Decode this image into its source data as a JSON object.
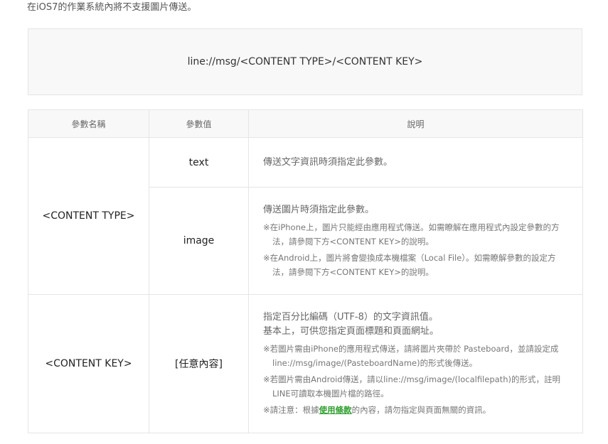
{
  "intro_text": "在iOS7的作業系統內將不支援圖片傳送。",
  "url_scheme": "line://msg/<CONTENT TYPE>/<CONTENT KEY>",
  "table": {
    "headers": [
      "參數名稱",
      "參數值",
      "說明"
    ],
    "content_type": {
      "name": "<CONTENT TYPE>",
      "text": {
        "value": "text",
        "desc": "傳送文字資訊時須指定此參數。"
      },
      "image": {
        "value": "image",
        "desc": "傳送圖片時須指定此參數。",
        "note1": "※在iPhone上，圖片只能經由應用程式傳送。如需瞭解在應用程式內設定參數的方法，請參閱下方<CONTENT KEY>的說明。",
        "note2": "※在Android上，圖片將會變換成本機檔案（Local File）。如需瞭解參數的設定方法，請參閱下方<CONTENT KEY>的說明。"
      }
    },
    "content_key": {
      "name": "<CONTENT KEY>",
      "value": "[任意內容]",
      "desc1": "指定百分比編碼（UTF-8）的文字資訊值。",
      "desc2": "基本上，可供您指定頁面標題和頁面網址。",
      "note1": "※若圖片需由iPhone的應用程式傳送，請將圖片夾帶於 Pasteboard，並請設定成line://msg/image/(PasteboardName)的形式後傳送。",
      "note2": "※若圖片需由Android傳送，請以line://msg/image/(localfilepath)的形式，註明LINE可讀取本機圖片檔的路徑。",
      "note3_prefix": "※請注意：根據",
      "note3_link": "使用條款",
      "note3_suffix": "的內容，請勿指定與頁面無關的資訊。"
    }
  },
  "colors": {
    "link": "#2e9e2e",
    "border": "#e5e5e5",
    "header_bg": "#f8f8f8"
  }
}
